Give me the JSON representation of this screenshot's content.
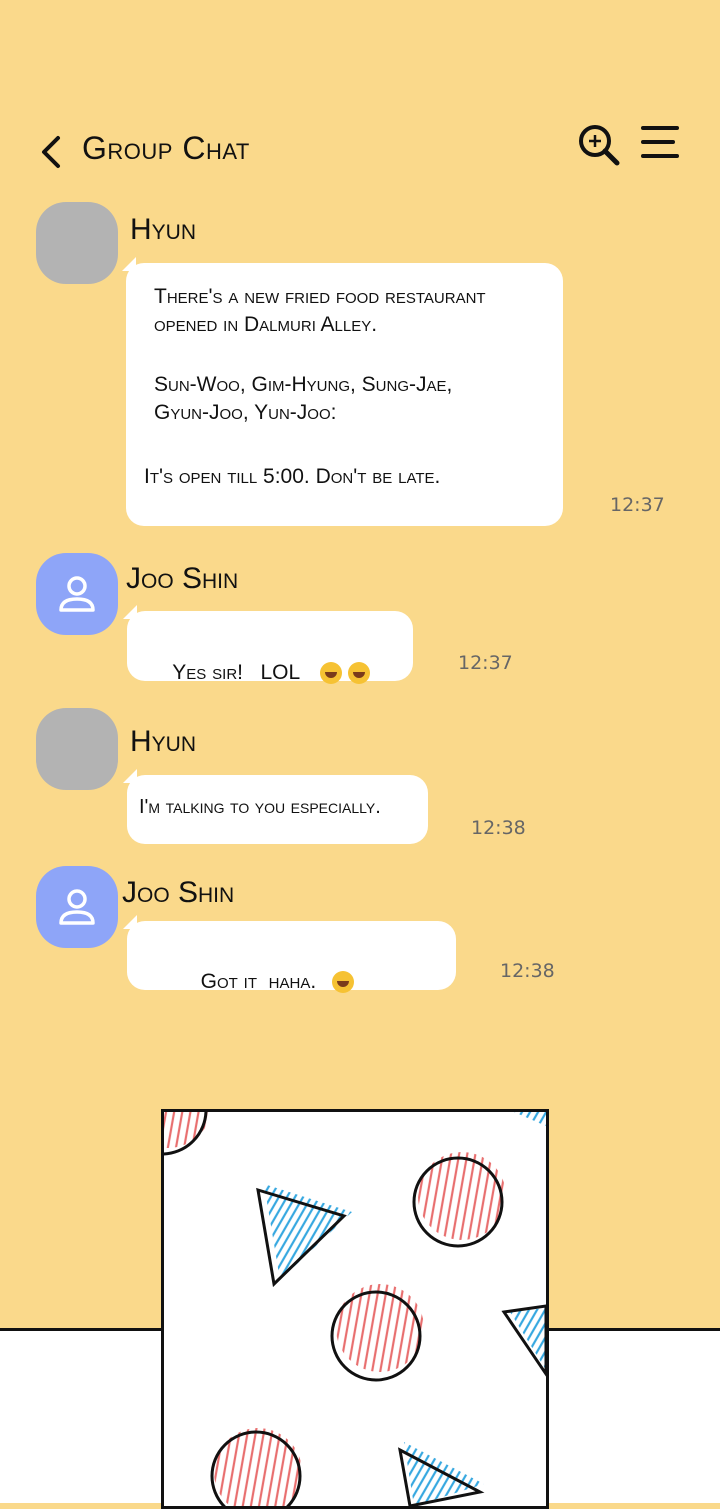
{
  "header": {
    "title": "Group Chat",
    "back_icon": "chevron-left-icon",
    "search_icon": "zoom-in-icon",
    "menu_icon": "hamburger-menu-icon"
  },
  "colors": {
    "background": "#fad98b",
    "bubble": "#ffffff",
    "avatar_gray": "#b3b3b3",
    "avatar_blue": "#8ea5f8",
    "stripe_red": "#e86f6f",
    "stripe_blue": "#37a8e0"
  },
  "messages": [
    {
      "sender": "Hyun",
      "lines": [
        "There's a new fried food restaurant",
        "opened in Dalmuri Alley.",
        "Sun-Woo, Gim-Hyung, Sung-Jae,",
        "Gyun-Joo, Yun-Joo:",
        "It's open till 5:00. Don't be late."
      ],
      "time": "12:37"
    },
    {
      "sender": "Joo Shin",
      "text": "Yes sir!   LOL",
      "time": "12:37"
    },
    {
      "sender": "Hyun",
      "text": "I'm talking to you especially.",
      "time": "12:38"
    },
    {
      "sender": "Joo Shin",
      "text": "Got it  haha.",
      "time": "12:38"
    }
  ]
}
